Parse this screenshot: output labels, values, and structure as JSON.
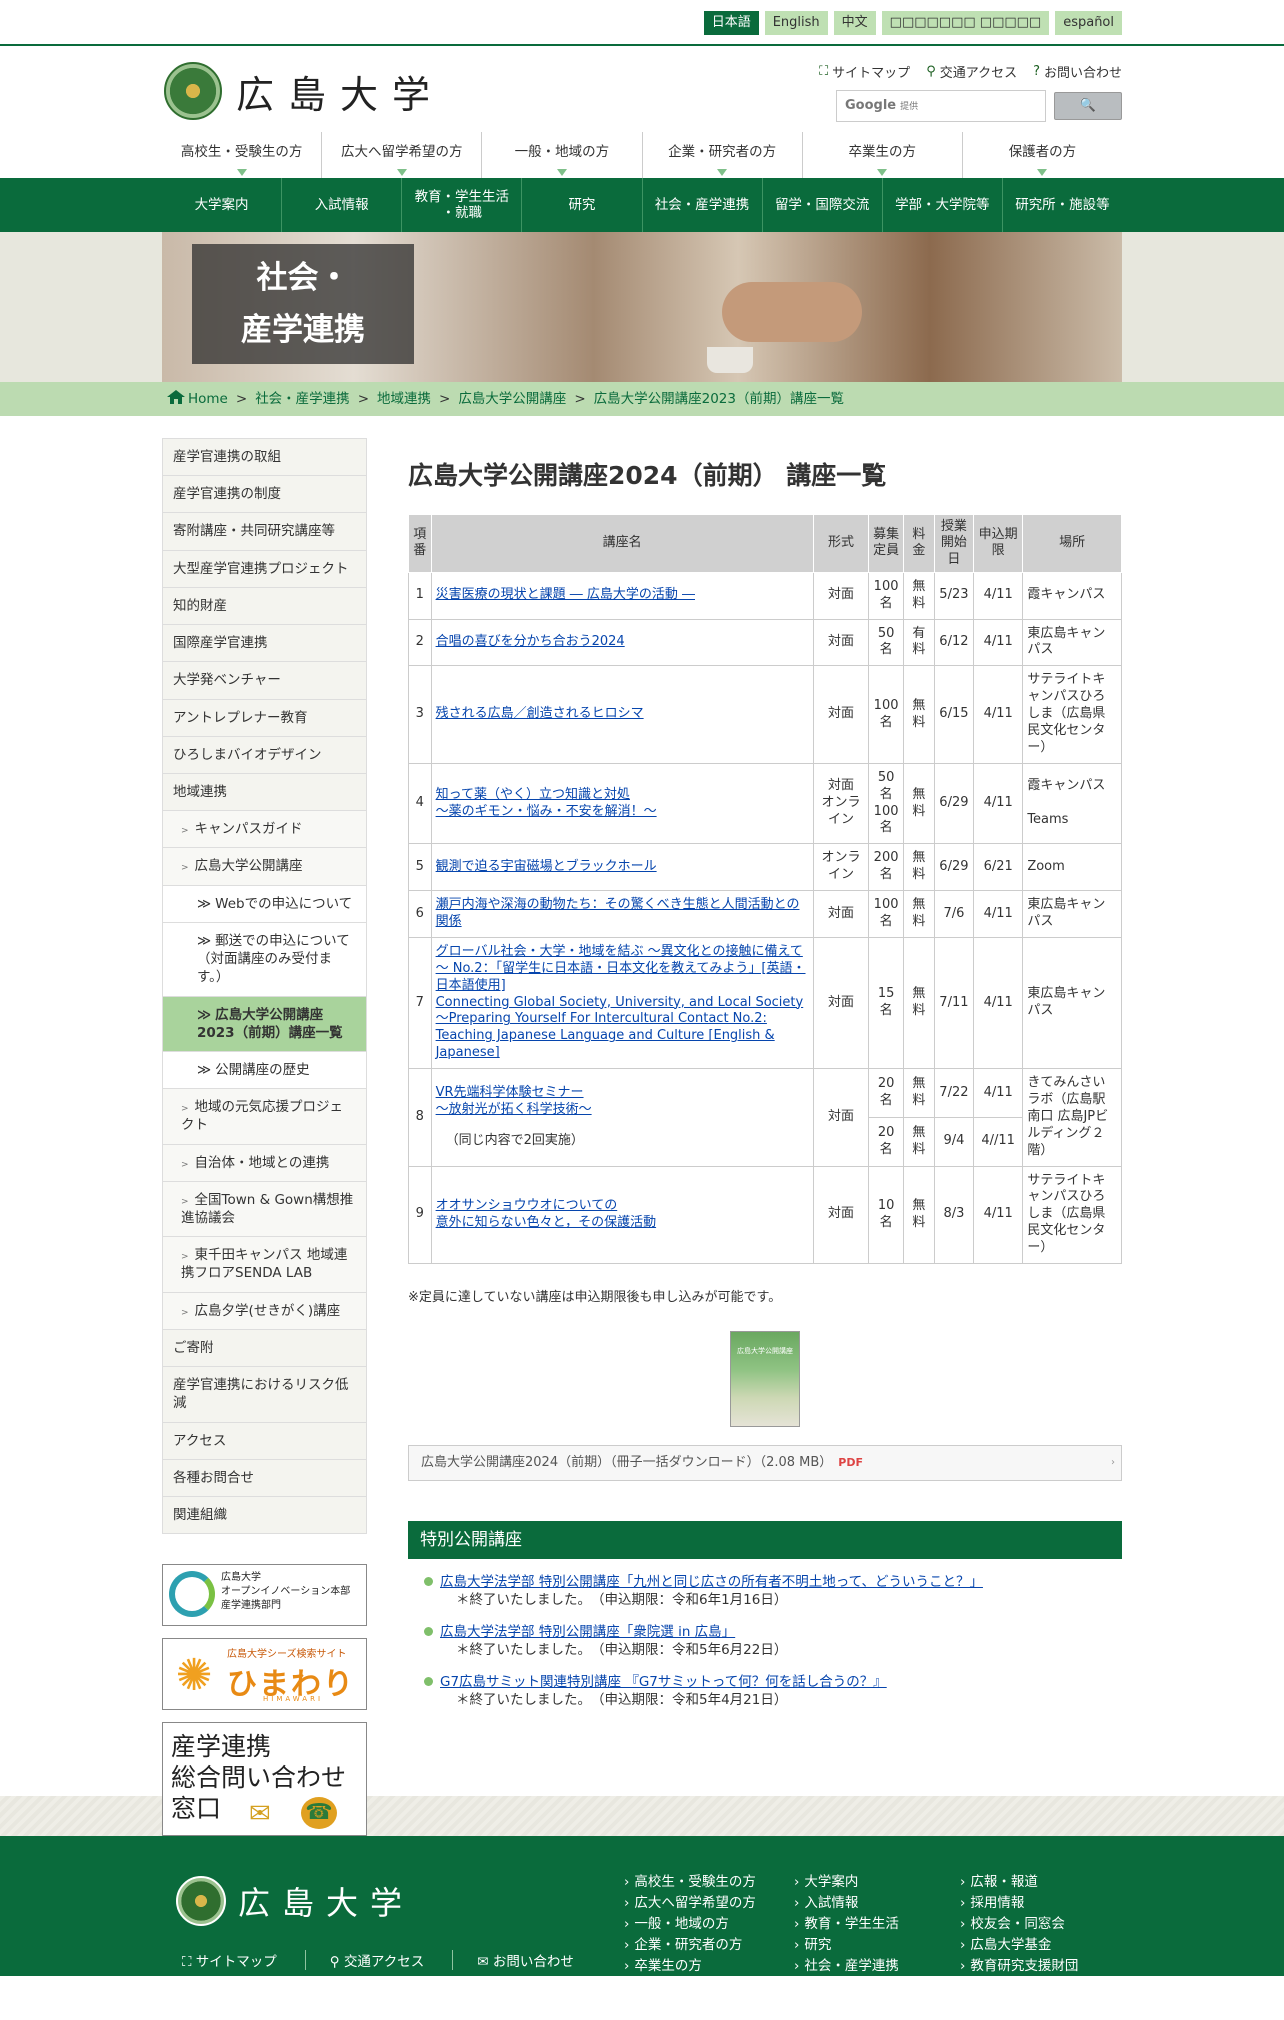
{
  "langs": [
    {
      "label": "日本語",
      "active": true
    },
    {
      "label": "English"
    },
    {
      "label": "中文"
    },
    {
      "label": "□□□□□□□ □□□□□"
    },
    {
      "label": "español"
    }
  ],
  "header": {
    "logo": "広島大学",
    "utility": [
      "サイトマップ",
      "交通アクセス",
      "お問い合わせ"
    ],
    "search_placeholder": "Google",
    "search_hint": "提供",
    "search_button": "🔍"
  },
  "audience": [
    "高校生・受験生の方",
    "広大へ留学希望の方",
    "一般・地域の方",
    "企業・研究者の方",
    "卒業生の方",
    "保護者の方"
  ],
  "gnav": [
    "大学案内",
    "入試情報",
    "教育・学生生活\n・就職",
    "研究",
    "社会・産学連携",
    "留学・国際交流",
    "学部・大学院等",
    "研究所・施設等"
  ],
  "hero": {
    "title": "社会・\n産学連携"
  },
  "breadcrumb": [
    "Home",
    "社会・産学連携",
    "地域連携",
    "広島大学公開講座",
    "広島大学公開講座2023（前期）講座一覧"
  ],
  "side": [
    {
      "label": "産学官連携の取組",
      "lv": 1
    },
    {
      "label": "産学官連携の制度",
      "lv": 1
    },
    {
      "label": "寄附講座・共同研究講座等",
      "lv": 1
    },
    {
      "label": "大型産学官連携プロジェクト",
      "lv": 1
    },
    {
      "label": "知的財産",
      "lv": 1
    },
    {
      "label": "国際産学官連携",
      "lv": 1
    },
    {
      "label": "大学発ベンチャー",
      "lv": 1
    },
    {
      "label": "アントレプレナー教育",
      "lv": 1
    },
    {
      "label": "ひろしまバイオデザイン",
      "lv": 1
    },
    {
      "label": "地域連携",
      "lv": 1
    },
    {
      "label": "キャンパスガイド",
      "lv": 2
    },
    {
      "label": "広島大学公開講座",
      "lv": 2
    },
    {
      "label": "Webでの申込について",
      "lv": 3
    },
    {
      "label": "郵送での申込について（対面講座のみ受付ます。）",
      "lv": 3
    },
    {
      "label": "広島大学公開講座2023（前期）講座一覧",
      "lv": 3,
      "active": true
    },
    {
      "label": "公開講座の歴史",
      "lv": 3
    },
    {
      "label": "地域の元気応援プロジェクト",
      "lv": 2
    },
    {
      "label": "自治体・地域との連携",
      "lv": 2
    },
    {
      "label": "全国Town & Gown構想推進協議会",
      "lv": 2
    },
    {
      "label": "東千田キャンパス 地域連携フロアSENDA LAB",
      "lv": 2
    },
    {
      "label": "広島夕学(せきがく)講座",
      "lv": 2
    },
    {
      "label": "ご寄附",
      "lv": 1
    },
    {
      "label": "産学官連携におけるリスク低減",
      "lv": 1
    },
    {
      "label": "アクセス",
      "lv": 1
    },
    {
      "label": "各種お問合せ",
      "lv": 1
    },
    {
      "label": "関連組織",
      "lv": 1
    }
  ],
  "banners": {
    "b1": [
      "広島大学",
      "オープンイノベーション本部",
      "産学連携部門"
    ],
    "b2": {
      "small": "広島大学シーズ検索サイト",
      "big": "ひまわり",
      "roman": "HIMAWARI"
    },
    "b3": [
      "産学連携",
      "総合問い合わせ",
      "窓口"
    ]
  },
  "main": {
    "title": "広島大学公開講座2024（前期） 講座一覧",
    "headers": [
      "項番",
      "講座名",
      "形式",
      "募集定員",
      "料金",
      "授業開始日",
      "申込期限",
      "場所"
    ],
    "rows": [
      {
        "no": "1",
        "name": "災害医療の現状と課題 ― 広島大学の活動 ―",
        "form": "対面",
        "cap": "100名",
        "fee": "無料",
        "start": "5/23",
        "dead": "4/11",
        "place": "霞キャンパス"
      },
      {
        "no": "2",
        "name": "合唱の喜びを分かち合おう2024",
        "form": "対面",
        "cap": "50名",
        "fee": "有料",
        "start": "6/12",
        "dead": "4/11",
        "place": "東広島キャンパス"
      },
      {
        "no": "3",
        "name": "残される広島／創造されるヒロシマ",
        "form": "対面",
        "cap": "100名",
        "fee": "無料",
        "start": "6/15",
        "dead": "4/11",
        "place": "サテライトキャンパスひろしま（広島県民文化センター）"
      },
      {
        "no": "4",
        "name": "知って薬（やく）立つ知識と対処\n～薬のギモン・悩み・不安を解消！～",
        "form": "対面\nオンライン",
        "cap": "50名\n100名",
        "fee": "無料",
        "start": "6/29",
        "dead": "4/11",
        "place": "霞キャンパス\n\nTeams"
      },
      {
        "no": "5",
        "name": "観測で迫る宇宙磁場とブラックホール",
        "form": "オンライン",
        "cap": "200名",
        "fee": "無料",
        "start": "6/29",
        "dead": "6/21",
        "place": "Zoom"
      },
      {
        "no": "6",
        "name": "瀬戸内海や深海の動物たち：その驚くべき生態と人間活動との関係",
        "form": "対面",
        "cap": "100名",
        "fee": "無料",
        "start": "7/6",
        "dead": "4/11",
        "place": "東広島キャンパス"
      },
      {
        "no": "7",
        "name": "グローバル社会・大学・地域を結ぶ ～異文化との接触に備えて～ No.2：「留学生に日本語・日本文化を教えてみよう」[英語・日本語使用]\nConnecting Global Society, University, and Local Society～Preparing Yourself For Intercultural Contact No.2: Teaching Japanese Language and Culture [English & Japanese]",
        "form": "対面",
        "cap": "15名",
        "fee": "無料",
        "start": "7/11",
        "dead": "4/11",
        "place": "東広島キャンパス"
      },
      {
        "no": "8",
        "name": "VR先端科学体験セミナー\n～放射光が拓く科学技術～",
        "sub": "（同じ内容で2回実施）",
        "form": "対面",
        "cap": "20名",
        "fee": "無料",
        "start": "7/22",
        "dead": "4/11",
        "cap2": "20名",
        "fee2": "無料",
        "start2": "9/4",
        "dead2": "4//11",
        "place": "きてみんさいラボ（広島駅南口 広島JPビルディング２階）"
      },
      {
        "no": "9",
        "name": "オオサンショウウオについての\n意外に知らない色々と，その保護活動",
        "form": "対面",
        "cap": "10名",
        "fee": "無料",
        "start": "8/3",
        "dead": "4/11",
        "place": "サテライトキャンパスひろしま（広島県民文化センター）"
      }
    ],
    "note": "※定員に達していない講座は申込期限後も申し込みが可能です。",
    "booklet": "広島大学公開講座",
    "download": "広島大学公開講座2024（前期）（冊子一括ダウンロード）（2.08 MB）",
    "download_icon": "PDF",
    "special_title": "特別公開講座",
    "special": [
      {
        "link": "広島大学法学部 特別公開講座「九州と同じ広さの所有者不明土地って、どういうこと？」",
        "status": "＊終了いたしました。　（申込期限：令和6年1月16日）"
      },
      {
        "link": "広島大学法学部 特別公開講座「衆院選 in 広島」",
        "status": "＊終了いたしました。　（申込期限：令和5年6月22日）"
      },
      {
        "link": "G7広島サミット関連特別講座 『G7サミットって何？何を話し合うの？』",
        "status": "＊終了いたしました。　（申込期限：令和5年4月21日）"
      }
    ]
  },
  "footer": {
    "logo": "広島大学",
    "utility": [
      "サイトマップ",
      "交通アクセス",
      "お問い合わせ"
    ],
    "col1": [
      "高校生・受験生の方",
      "広大へ留学希望の方",
      "一般・地域の方",
      "企業・研究者の方",
      "卒業生の方"
    ],
    "col2": [
      "大学案内",
      "入試情報",
      "教育・学生生活",
      "研究",
      "社会・産学連携"
    ],
    "col3": [
      "広報・報道",
      "採用情報",
      "校友会・同窓会",
      "広島大学基金",
      "教育研究支援財団"
    ]
  }
}
